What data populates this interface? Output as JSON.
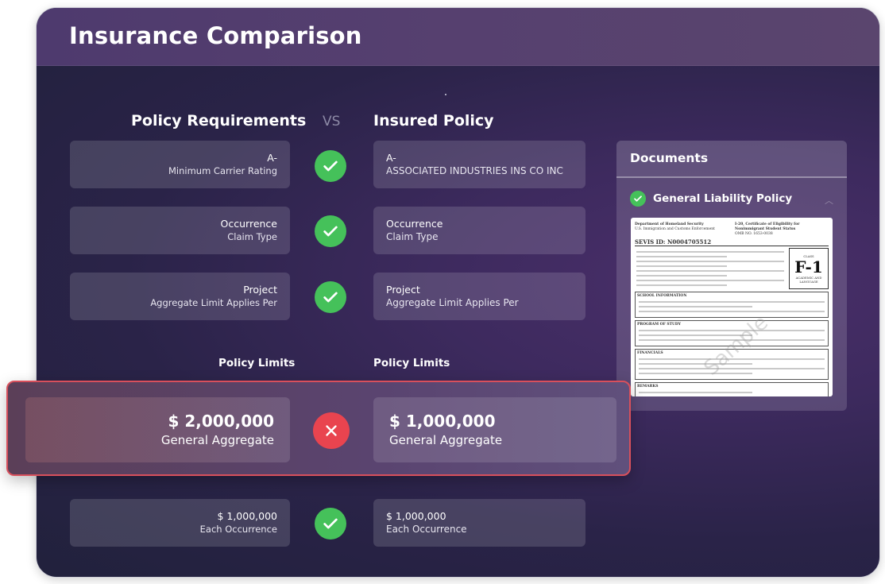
{
  "header": {
    "title": "Insurance Comparison"
  },
  "columns": {
    "left_title": "Policy Requirements",
    "vs_label": "VS",
    "right_title": "Insured Policy"
  },
  "rows": [
    {
      "req_value": "A-",
      "req_label": "Minimum Carrier Rating",
      "ins_value": "A-",
      "ins_label": "ASSOCIATED INDUSTRIES INS CO INC",
      "status": "match"
    },
    {
      "req_value": "Occurrence",
      "req_label": "Claim Type",
      "ins_value": "Occurrence",
      "ins_label": "Claim Type",
      "status": "match"
    },
    {
      "req_value": "Project",
      "req_label": "Aggregate Limit Applies Per",
      "ins_value": "Project",
      "ins_label": "Aggregate Limit Applies Per",
      "status": "match"
    }
  ],
  "limits": {
    "left_title": "Policy Limits",
    "right_title": "Policy Limits",
    "highlighted": {
      "req_value": "$ 2,000,000",
      "req_label": "General Aggregate",
      "ins_value": "$ 1,000,000",
      "ins_label": "General Aggregate",
      "status": "mismatch"
    },
    "occurrence": {
      "req_value": "$ 1,000,000",
      "req_label": "Each Occurrence",
      "ins_value": "$ 1,000,000",
      "ins_label": "Each Occurrence",
      "status": "match"
    }
  },
  "documents": {
    "title": "Documents",
    "items": [
      {
        "name": "General Liability Policy",
        "status": "verified"
      }
    ],
    "preview": {
      "agency": "Department of Homeland Security",
      "agency_sub": "U.S. Immigration and Customs Enforcement",
      "form_title": "I-20, Certificate of Eligibility for Nonimmigrant Student Status",
      "omb": "OMB NO. 1653-0038",
      "sevis_id": "SEVIS ID: N0004705512",
      "class_label": "CLASS",
      "class_value": "F-1",
      "class_sub": "ACADEMIC AND LANGUAGE",
      "section_school": "SCHOOL INFORMATION",
      "section_program": "PROGRAM OF STUDY",
      "section_financials": "FINANCIALS",
      "section_remarks": "REMARKS",
      "watermark": "Sample"
    }
  },
  "colors": {
    "match": "#45c15a",
    "mismatch": "#e9444f",
    "highlight_border": "#d8505c"
  },
  "icons": {
    "match": "check-icon",
    "mismatch": "close-icon"
  }
}
